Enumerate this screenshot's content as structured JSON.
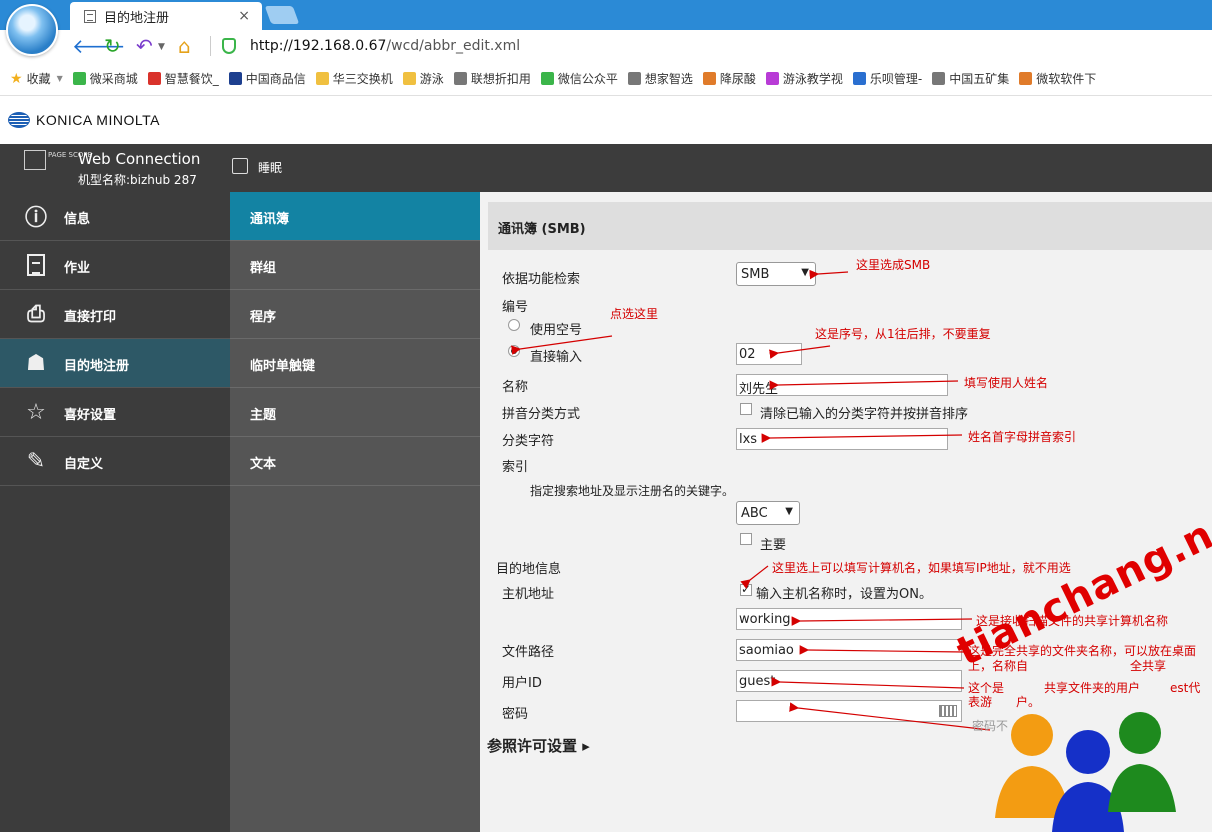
{
  "browser": {
    "tab_title": "目的地注册",
    "tab_close": "×",
    "url_host": "http://192.168.0.67",
    "url_path": "/wcd/abbr_edit.xml",
    "bookmarks": [
      {
        "label": "收藏",
        "color": "#f2b01e"
      },
      {
        "label": "微采商城",
        "color": "#3bb54a"
      },
      {
        "label": "智慧餐饮_",
        "color": "#d9322b"
      },
      {
        "label": "中国商品信",
        "color": "#1d3f8f"
      },
      {
        "label": "华三交换机",
        "color": "#f0c040"
      },
      {
        "label": "游泳",
        "color": "#f0c040"
      },
      {
        "label": "联想折扣用",
        "color": "#777777"
      },
      {
        "label": "微信公众平",
        "color": "#3bb54a"
      },
      {
        "label": "想家智选",
        "color": "#777777"
      },
      {
        "label": "降尿酸",
        "color": "#e07b2a"
      },
      {
        "label": "游泳教学视",
        "color": "#b83bd6"
      },
      {
        "label": "乐呗管理-",
        "color": "#2a6fd0"
      },
      {
        "label": "中国五矿集",
        "color": "#777777"
      },
      {
        "label": "微软软件下",
        "color": "#e07b2a"
      }
    ]
  },
  "brand": {
    "name": "KONICA MINOLTA"
  },
  "header": {
    "page_scope": "PAGE SCOPE",
    "title": "Web Connection",
    "model": "机型名称:bizhub 287",
    "sleep": "睡眠"
  },
  "leftnav": {
    "items": [
      {
        "label": "信息",
        "icon": "info-icon",
        "active": false
      },
      {
        "label": "作业",
        "icon": "job-icon",
        "active": false
      },
      {
        "label": "直接打印",
        "icon": "print-icon",
        "active": false
      },
      {
        "label": "目的地注册",
        "icon": "address-book-icon",
        "active": true
      },
      {
        "label": "喜好设置",
        "icon": "star-icon",
        "active": false
      },
      {
        "label": "自定义",
        "icon": "customize-icon",
        "active": false
      }
    ]
  },
  "subnav": {
    "items": [
      {
        "label": "通讯簿",
        "active": true
      },
      {
        "label": "群组",
        "active": false
      },
      {
        "label": "程序",
        "active": false
      },
      {
        "label": "临时单触键",
        "active": false
      },
      {
        "label": "主题",
        "active": false
      },
      {
        "label": "文本",
        "active": false
      }
    ]
  },
  "form": {
    "panel_title": "通讯簿 (SMB)",
    "search_by_function_label": "依据功能检索",
    "search_by_function_value": "SMB",
    "number_label": "编号",
    "use_empty_label": "使用空号",
    "direct_input_label": "直接输入",
    "number_value": "02",
    "name_label": "名称",
    "name_value": "刘先生",
    "pinyin_label": "拼音分类方式",
    "pinyin_option": "清除已输入的分类字符并按拼音排序",
    "category_label": "分类字符",
    "category_value": "lxs",
    "index_label": "索引",
    "index_hint": "指定搜索地址及显示注册名的关键字。",
    "index_value": "ABC",
    "main_label": "主要",
    "dest_info_label": "目的地信息",
    "host_label": "主机地址",
    "host_option": "输入主机名称时，设置为ON。",
    "host_value": "working",
    "path_label": "文件路径",
    "path_value": "saomiao",
    "userid_label": "用户ID",
    "userid_value": "guest",
    "password_label": "密码",
    "permission_link": "参照许可设置"
  },
  "annotations": {
    "smb": "这里选成SMB",
    "click_here": "点选这里",
    "serial": "这是序号，从1往后排，不要重复",
    "name": "填写使用人姓名",
    "pinyin": "姓名首字母拼音索引",
    "host_check": "这里选上可以填写计算机名，如果填写IP地址，就不用选",
    "host_name": "这是接收扫描文件的共享计算机名称",
    "path_1": "这是完全共享的文件夹名称，可以放在桌面",
    "path_2": "上，名称自",
    "path_3": "全共享",
    "user_1": "这个是",
    "user_2": "共享文件夹的用户",
    "user_3": "est代",
    "user_4": "表游",
    "user_5": "户。",
    "pwd": "密码不"
  },
  "watermark": {
    "text": "tianchang.net",
    "colors": [
      "#f39c12",
      "#1530c8",
      "#1e8a1e"
    ]
  }
}
